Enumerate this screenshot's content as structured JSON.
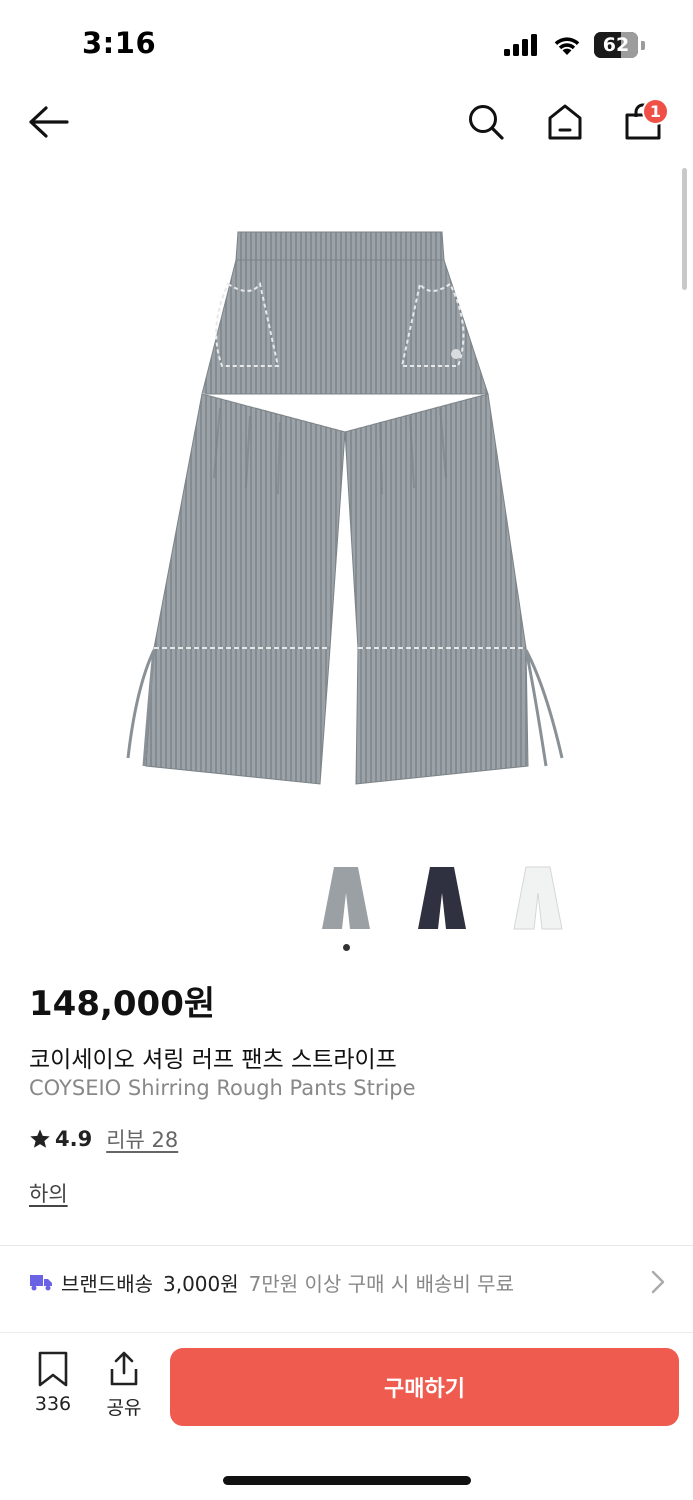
{
  "status_bar": {
    "time": "3:16",
    "battery": "62",
    "battery_fraction": 0.62
  },
  "nav": {
    "cart_count": "1"
  },
  "product": {
    "image_icon": "striped-gray-wide-pants",
    "thumbnails": [
      {
        "color": "#9aa0a4",
        "icon": "gray-pants-thumb"
      },
      {
        "color": "#2f3140",
        "icon": "navy-pants-thumb"
      },
      {
        "color": "#f1f2f2",
        "icon": "white-pants-thumb"
      }
    ],
    "price": "148,000원",
    "name_ko": "코이세이오 셔링 러프 팬츠 스트라이프",
    "name_en": "COYSEIO Shirring Rough Pants Stripe",
    "rating": "4.9",
    "review_label": "리뷰 28",
    "category": "하의"
  },
  "shipping": {
    "label": "브랜드배송",
    "fee": "3,000원",
    "note": "7만원 이상 구매 시 배송비 무료"
  },
  "bottom_bar": {
    "bookmark_count": "336",
    "share_label": "공유",
    "buy_label": "구매하기"
  },
  "colors": {
    "accent": "#ef5b4f",
    "badge": "#ef4f45",
    "ship_icon": "#6a63e6"
  }
}
